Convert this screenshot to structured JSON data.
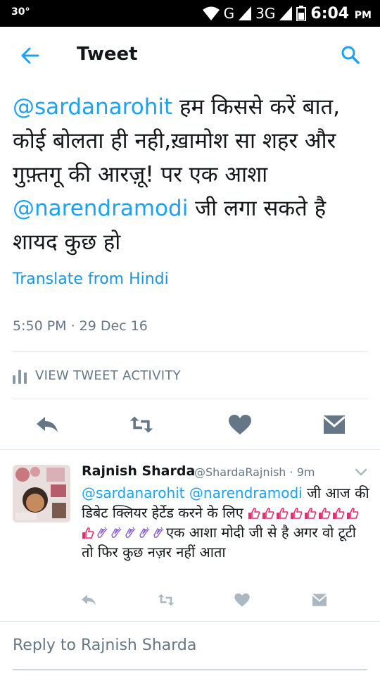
{
  "status_bar": {
    "temperature": "30°",
    "network_g": "G",
    "network_3g": "3G",
    "time": "6:04",
    "ampm": "PM"
  },
  "header": {
    "title": "Tweet"
  },
  "tweet": {
    "mention1": "@sardanarohit",
    "text_part1": " हम किससे करें बात, कोई बोलता ही नही,ख़ामोश सा शहर और गुफ़्तगू की आरज़ू! पर एक आशा ",
    "mention2": "@narendramodi",
    "text_part2": " जी लगा सकते है शायद कुछ हो",
    "translate_label": "Translate from Hindi",
    "timestamp": "5:50 PM · 29 Dec 16",
    "activity_label": "VIEW TWEET ACTIVITY"
  },
  "reply_tweet": {
    "author_name": "Rajnish Sharda",
    "author_handle": "@ShardaRajnish · 9m",
    "mention1": "@sardanarohit",
    "mention2": "@narendramodi",
    "text_part1": " जी आज की डिबेट क्लियर हेर्टेड करने के लिए ",
    "text_part2": "एक आशा मोदी जी से है अगर वो टूटी तो फिर कुछ नज़र नहीं आता"
  },
  "compose": {
    "placeholder": "Reply to Rajnish Sharda"
  },
  "colors": {
    "accent": "#1da1f2",
    "icon_gray": "#657786",
    "like_gray": "#aab8c2"
  }
}
